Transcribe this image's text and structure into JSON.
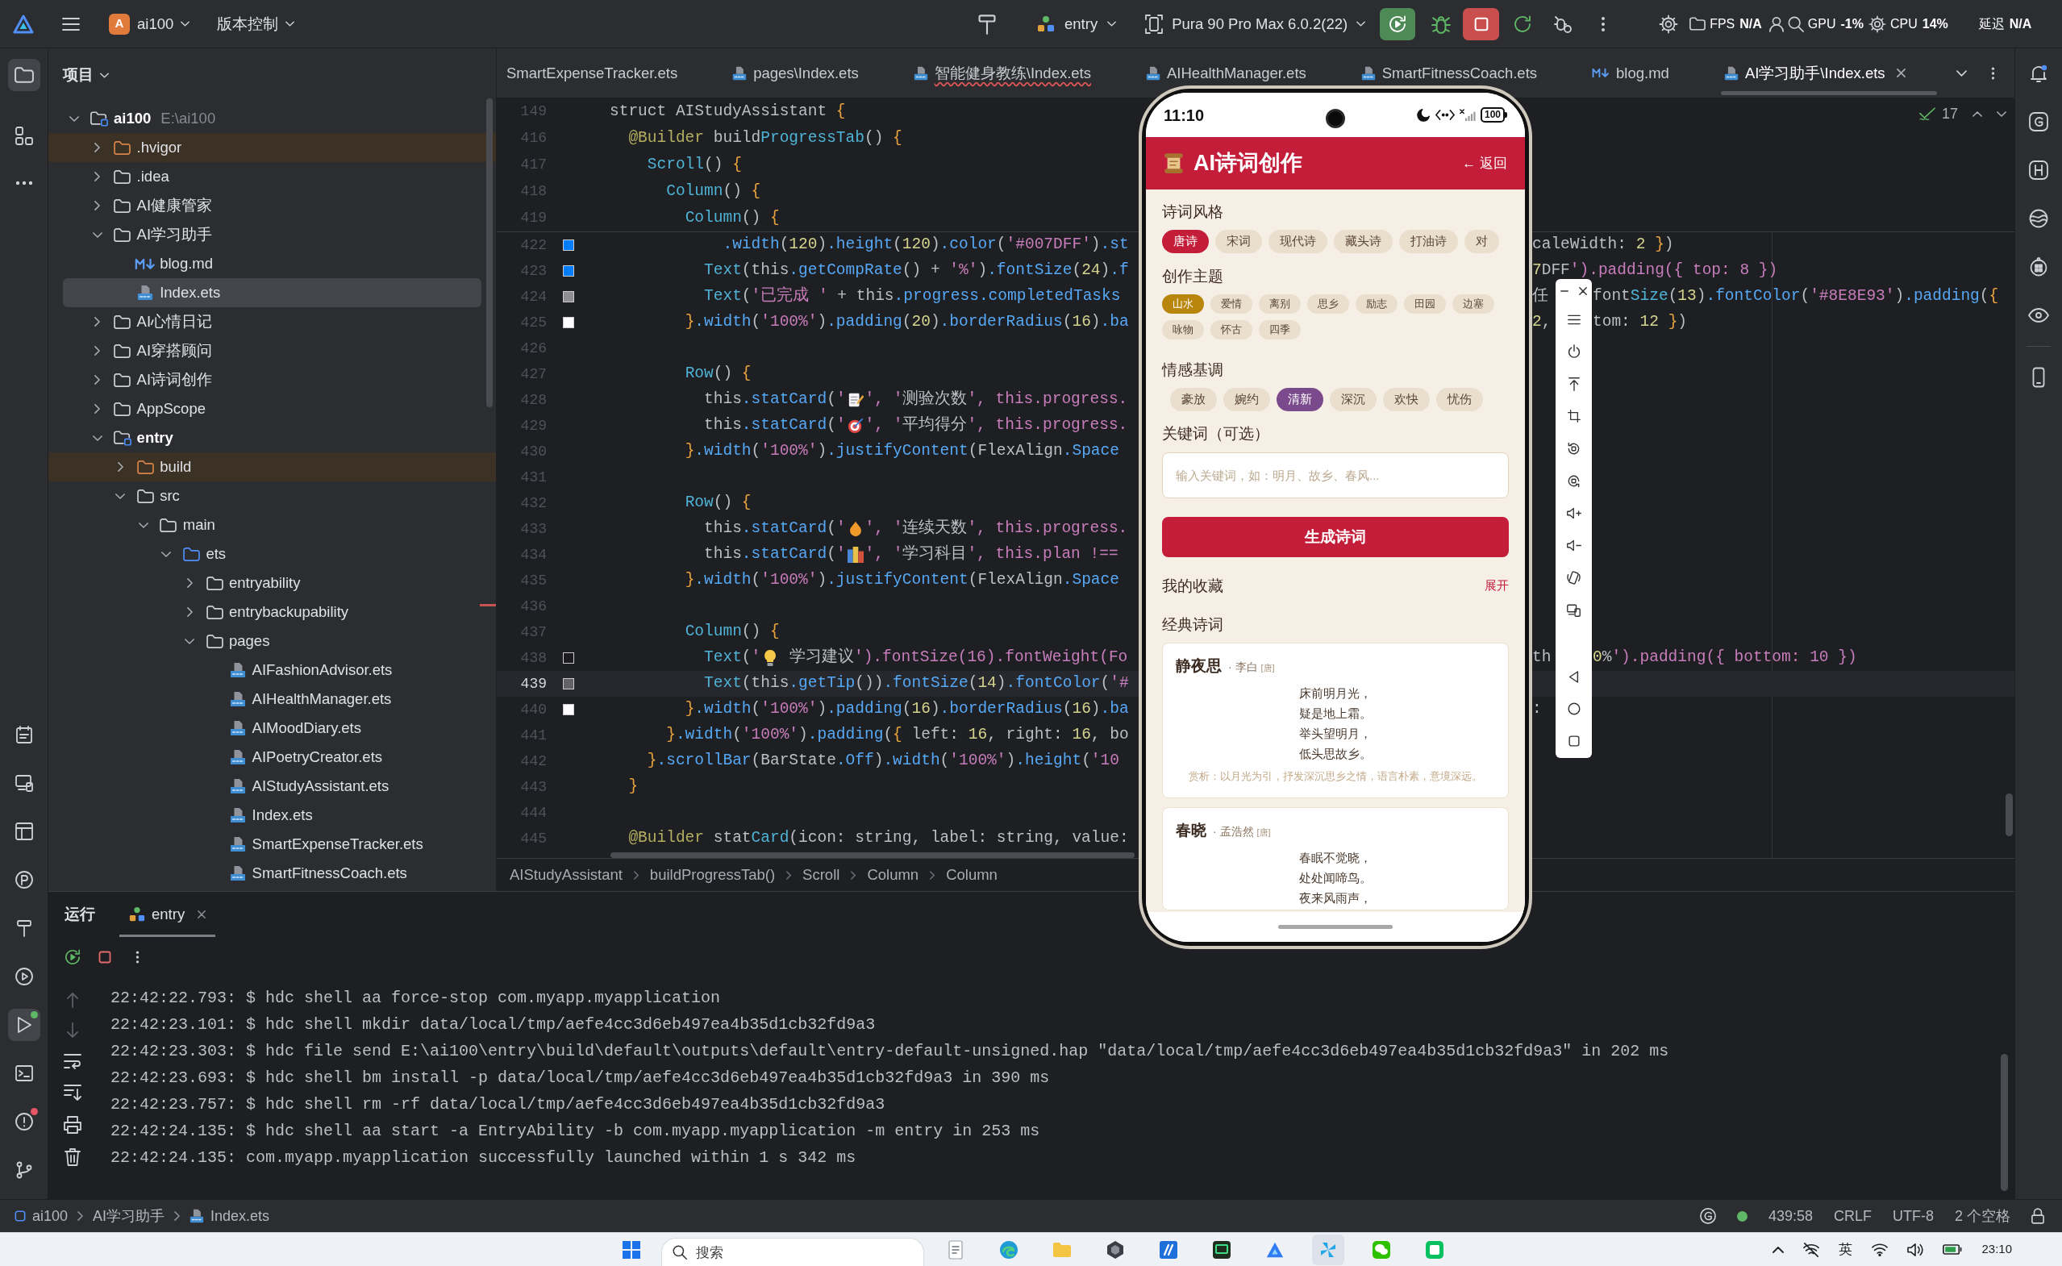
{
  "title_bar": {
    "project_badge": "A",
    "project": "ai100",
    "vcs": "版本控制",
    "run_config": "entry",
    "device": "Pura 90 Pro Max 6.0.2(22)",
    "stats": [
      {
        "label": "FPS",
        "value": "N/A"
      },
      {
        "label": "GPU",
        "value": "-1%"
      },
      {
        "label": "CPU",
        "value": "14%"
      },
      {
        "label": "延迟",
        "value": "N/A"
      }
    ]
  },
  "left_tools": [
    {
      "selected": true
    },
    {
      "selected": false
    },
    {
      "selected": false
    },
    {
      "selected": false
    },
    {
      "selected": false
    },
    {
      "selected": false
    },
    {
      "selected": false
    },
    {
      "selected": false
    },
    {
      "selected": false
    },
    {
      "selected": true,
      "color": "#5fb865"
    },
    {
      "selected": false
    },
    {
      "selected": false,
      "color": "#e55765"
    },
    {
      "selected": false
    }
  ],
  "project_panel": {
    "title": "项目",
    "tree": [
      {
        "name": "ai100",
        "kind": "module",
        "path": "E:\\ai100",
        "expanded": true,
        "selected": false,
        "children": [
          {
            "name": ".hvigor",
            "kind": "excluded",
            "expanded": false,
            "selected": false
          },
          {
            "name": ".idea",
            "kind": "folder",
            "expanded": false,
            "selected": false
          },
          {
            "name": "AI健康管家",
            "kind": "folder",
            "expanded": false,
            "selected": false
          },
          {
            "name": "AI学习助手",
            "kind": "folder",
            "expanded": true,
            "selected": false,
            "children": [
              {
                "name": "blog.md",
                "kind": "md",
                "selected": false
              },
              {
                "name": "Index.ets",
                "kind": "ets",
                "selected": true
              }
            ]
          },
          {
            "name": "AI心情日记",
            "kind": "folder",
            "expanded": false,
            "selected": false
          },
          {
            "name": "AI穿搭顾问",
            "kind": "folder",
            "expanded": false,
            "selected": false
          },
          {
            "name": "AI诗词创作",
            "kind": "folder",
            "expanded": false,
            "selected": false
          },
          {
            "name": "AppScope",
            "kind": "folder",
            "expanded": false,
            "selected": false
          },
          {
            "name": "entry",
            "kind": "module",
            "expanded": true,
            "selected": false,
            "children": [
              {
                "name": "build",
                "kind": "excluded",
                "expanded": false,
                "selected": false
              },
              {
                "name": "src",
                "kind": "folder",
                "expanded": true,
                "selected": false,
                "children": [
                  {
                    "name": "main",
                    "kind": "folder",
                    "expanded": true,
                    "selected": false,
                    "children": [
                      {
                        "name": "ets",
                        "kind": "source",
                        "expanded": true,
                        "selected": false,
                        "children": [
                          {
                            "name": "entryability",
                            "kind": "folder",
                            "expanded": false,
                            "selected": false
                          },
                          {
                            "name": "entrybackupability",
                            "kind": "folder",
                            "expanded": false,
                            "selected": false
                          },
                          {
                            "name": "pages",
                            "kind": "folder",
                            "expanded": true,
                            "selected": false,
                            "children": [
                              {
                                "name": "AIFashionAdvisor.ets",
                                "kind": "ets",
                                "selected": false
                              },
                              {
                                "name": "AIHealthManager.ets",
                                "kind": "ets",
                                "selected": false
                              },
                              {
                                "name": "AIMoodDiary.ets",
                                "kind": "ets",
                                "selected": false
                              },
                              {
                                "name": "AIPoetryCreator.ets",
                                "kind": "ets",
                                "selected": false
                              },
                              {
                                "name": "AIStudyAssistant.ets",
                                "kind": "ets",
                                "selected": false
                              },
                              {
                                "name": "Index.ets",
                                "kind": "ets",
                                "selected": false
                              },
                              {
                                "name": "SmartExpenseTracker.ets",
                                "kind": "ets",
                                "selected": false
                              },
                              {
                                "name": "SmartFitnessCoach.ets",
                                "kind": "ets",
                                "selected": false
                              }
                            ]
                          }
                        ]
                      }
                    ]
                  }
                ]
              }
            ]
          }
        ]
      }
    ]
  },
  "editor": {
    "tabs": [
      {
        "label": "SmartExpenseTracker.ets",
        "kind": "plain",
        "selected": false,
        "error": false
      },
      {
        "label": "pages\\Index.ets",
        "kind": "ets",
        "selected": false,
        "error": false
      },
      {
        "label": "智能健身教练\\Index.ets",
        "kind": "ets",
        "selected": false,
        "error": true
      },
      {
        "label": "AIHealthManager.ets",
        "kind": "ets",
        "selected": false,
        "error": false
      },
      {
        "label": "SmartFitnessCoach.ets",
        "kind": "ets",
        "selected": false,
        "error": false
      },
      {
        "label": "blog.md",
        "kind": "md",
        "selected": false,
        "error": false
      },
      {
        "label": "AI学习助手\\Index.ets",
        "kind": "ets",
        "selected": true,
        "error": false
      }
    ],
    "inspections": "17",
    "sticky_lines": [
      {
        "number": "149",
        "code": "struct AIStudyAssistant {"
      },
      {
        "number": "416",
        "code": "  @Builder buildProgressTab() {"
      },
      {
        "number": "417",
        "code": "    Scroll() {"
      },
      {
        "number": "418",
        "code": "      Column() {"
      },
      {
        "number": "419",
        "code": "        Column() {"
      }
    ],
    "lines": [
      {
        "number": "422",
        "kind": "text",
        "current": false,
        "color": "#007dff",
        "code": "            .width(120).height(120).color('#007DFF').st",
        "right": "caleWidth: 2 })"
      },
      {
        "number": "423",
        "kind": "text",
        "current": false,
        "color": "#007dff",
        "code": "          Text(this.getCompRate() + '%').fontSize(24).f",
        "right": "7DFF').padding({ top: 8 })"
      },
      {
        "number": "424",
        "kind": "text",
        "current": false,
        "color": "#8e8e93",
        "code": "          Text('已完成 ' + this.progress.completedTasks",
        "mid": "任",
        "right": "fontSize(13).fontColor('#8E8E93').padding({"
      },
      {
        "number": "425",
        "kind": "text",
        "current": false,
        "color": "#ffffff",
        "code": "        }.width('100%').padding(20).borderRadius(16).ba",
        "mid": "2,",
        "right": "tom: 12 })"
      },
      {
        "number": "426",
        "kind": "blank",
        "current": false
      },
      {
        "number": "427",
        "kind": "text",
        "current": false,
        "code": "        Row() {"
      },
      {
        "number": "428",
        "kind": "memo",
        "current": false,
        "code": "          this.statCard('",
        "code_after": "', '测验次数', this.progress."
      },
      {
        "number": "429",
        "kind": "target",
        "current": false,
        "code": "          this.statCard('",
        "code_after": "', '平均得分', this.progress."
      },
      {
        "number": "430",
        "kind": "text",
        "current": false,
        "code": "        }.width('100%').justifyContent(FlexAlign.Space"
      },
      {
        "number": "431",
        "kind": "blank",
        "current": false
      },
      {
        "number": "432",
        "kind": "text",
        "current": false,
        "code": "        Row() {"
      },
      {
        "number": "433",
        "kind": "flame",
        "current": false,
        "code": "          this.statCard('",
        "code_after": "', '连续天数', this.progress."
      },
      {
        "number": "434",
        "kind": "books",
        "current": false,
        "code": "          this.statCard('",
        "code_after": "', '学习科目', this.plan !=="
      },
      {
        "number": "435",
        "kind": "text",
        "current": false,
        "code": "        }.width('100%').justifyContent(FlexAlign.Space"
      },
      {
        "number": "436",
        "kind": "blank",
        "current": false
      },
      {
        "number": "437",
        "kind": "text",
        "current": false,
        "code": "        Column() {"
      },
      {
        "number": "438",
        "kind": "bulb",
        "current": false,
        "color": "#1c1c1e",
        "code": "          Text('",
        "code_after": " 学习建议').fontSize(16).fontWeight(Fo",
        "mid": "th",
        "right": "0%').padding({ bottom: 10 })"
      },
      {
        "number": "439",
        "kind": "text",
        "current": true,
        "color": "#636366",
        "code": "          Text(this.getTip()).fontSize(14).fontColor('#"
      },
      {
        "number": "440",
        "kind": "text",
        "current": false,
        "color": "#ffffff",
        "code": "        }.width('100%').padding(16).borderRadius(16).ba",
        "mid": ":"
      },
      {
        "number": "441",
        "kind": "text",
        "current": false,
        "code": "      }.width('100%').padding({ left: 16, right: 16, bo"
      },
      {
        "number": "442",
        "kind": "text",
        "current": false,
        "code": "    }.scrollBar(BarState.Off).width('100%').height('10"
      },
      {
        "number": "443",
        "kind": "text",
        "current": false,
        "code": "  }"
      },
      {
        "number": "444",
        "kind": "blank",
        "current": false
      },
      {
        "number": "445",
        "kind": "text",
        "current": false,
        "code": "  @Builder statCard(icon: string, label: string, value:"
      }
    ],
    "breadcrumbs": [
      "AIStudyAssistant",
      "buildProgressTab()",
      "Scroll",
      "Column",
      "Column"
    ]
  },
  "phone": {
    "time": "11:10",
    "battery": "100",
    "title": "AI诗词创作",
    "back": "← 返回",
    "style": {
      "title": "诗词风格",
      "options": [
        {
          "label": "唐诗",
          "selected": true
        },
        {
          "label": "宋词",
          "selected": false
        },
        {
          "label": "现代诗",
          "selected": false
        },
        {
          "label": "藏头诗",
          "selected": false
        },
        {
          "label": "打油诗",
          "selected": false
        },
        {
          "label": "对",
          "selected": false
        }
      ]
    },
    "theme": {
      "title": "创作主题",
      "options": [
        {
          "label": "山水",
          "selected": true
        },
        {
          "label": "爱情",
          "selected": false
        },
        {
          "label": "离别",
          "selected": false
        },
        {
          "label": "思乡",
          "selected": false
        },
        {
          "label": "励志",
          "selected": false
        },
        {
          "label": "田园",
          "selected": false
        },
        {
          "label": "边塞",
          "selected": false
        },
        {
          "label": "咏物",
          "selected": false
        },
        {
          "label": "怀古",
          "selected": false
        },
        {
          "label": "四季",
          "selected": false
        }
      ]
    },
    "mood": {
      "title": "情感基调",
      "options": [
        {
          "label": "豪放",
          "selected": false
        },
        {
          "label": "婉约",
          "selected": false
        },
        {
          "label": "清新",
          "selected": true
        },
        {
          "label": "深沉",
          "selected": false
        },
        {
          "label": "欢快",
          "selected": false
        },
        {
          "label": "忧伤",
          "selected": false
        }
      ]
    },
    "keywords": {
      "label": "关键词（可选）",
      "placeholder": "输入关键词，如：明月、故乡、春风..."
    },
    "generate": "生成诗词",
    "favorites": {
      "title": "我的收藏",
      "toggle": "展开"
    },
    "classics": {
      "title": "经典诗词",
      "poems": [
        {
          "title": "静夜思",
          "author": "· 李白",
          "dynasty": "[唐]",
          "lines": [
            "床前明月光，",
            "疑是地上霜。",
            "举头望明月，",
            "低头思故乡。"
          ],
          "note": "赏析：以月光为引，抒发深沉思乡之情，语言朴素，意境深远。"
        },
        {
          "title": "春晓",
          "author": "· 孟浩然",
          "dynasty": "[唐]",
          "lines": [
            "春眠不觉晓，",
            "处处闻啼鸟。",
            "夜来风雨声，"
          ]
        }
      ]
    }
  },
  "run_panel": {
    "title": "运行",
    "tabs": [
      {
        "label": "entry",
        "selected": true
      }
    ],
    "console": [
      "22:42:22.793: $ hdc shell aa force-stop com.myapp.myapplication",
      "22:42:23.101: $ hdc shell mkdir data/local/tmp/aefe4cc3d6eb497ea4b35d1cb32fd9a3",
      "22:42:23.303: $ hdc file send E:\\ai100\\entry\\build\\default\\outputs\\default\\entry-default-unsigned.hap \"data/local/tmp/aefe4cc3d6eb497ea4b35d1cb32fd9a3\" in 202 ms",
      "22:42:23.693: $ hdc shell bm install -p data/local/tmp/aefe4cc3d6eb497ea4b35d1cb32fd9a3 in 390 ms",
      "22:42:23.757: $ hdc shell rm -rf data/local/tmp/aefe4cc3d6eb497ea4b35d1cb32fd9a3",
      "22:42:24.135: $ hdc shell aa start -a EntryAbility -b com.myapp.myapplication -m entry in 253 ms",
      "22:42:24.135: com.myapp.myapplication successfully launched within 1 s 342 ms"
    ]
  },
  "status_bar": {
    "path": [
      "ai100",
      "AI学习助手",
      "Index.ets"
    ],
    "position": "439:58",
    "line_ending": "CRLF",
    "encoding": "UTF-8",
    "indent": "2 个空格"
  },
  "taskbar": {
    "search": {
      "placeholder": "搜索"
    },
    "apps": [
      {
        "selected": false
      },
      {
        "selected": false
      },
      {
        "selected": false
      },
      {
        "selected": false
      },
      {
        "selected": false
      },
      {
        "selected": false
      },
      {
        "selected": false
      },
      {
        "selected": true
      },
      {
        "selected": false
      },
      {
        "selected": false
      }
    ],
    "input_method": "英",
    "time": "23:10"
  }
}
